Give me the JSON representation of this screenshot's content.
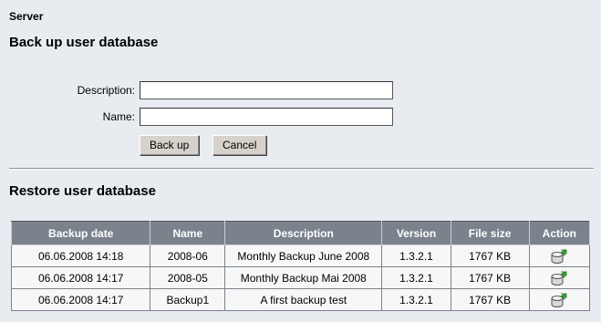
{
  "breadcrumb": "Server",
  "backup": {
    "title": "Back up user database",
    "description_label": "Description:",
    "description_value": "",
    "name_label": "Name:",
    "name_value": "",
    "backup_button": "Back up",
    "cancel_button": "Cancel"
  },
  "restore": {
    "title": "Restore user database",
    "columns": [
      "Backup date",
      "Name",
      "Description",
      "Version",
      "File size",
      "Action"
    ],
    "rows": [
      {
        "date": "06.06.2008 14:18",
        "name": "2008-06",
        "description": "Monthly Backup June 2008",
        "version": "1.3.2.1",
        "size": "1767 KB",
        "action_icon": "restore-icon"
      },
      {
        "date": "06.06.2008 14:17",
        "name": "2008-05",
        "description": "Monthly Backup Mai 2008",
        "version": "1.3.2.1",
        "size": "1767 KB",
        "action_icon": "restore-icon"
      },
      {
        "date": "06.06.2008 14:17",
        "name": "Backup1",
        "description": "A first backup test",
        "version": "1.3.2.1",
        "size": "1767 KB",
        "action_icon": "restore-icon"
      }
    ]
  },
  "colors": {
    "background": "#e8ecf1",
    "table_header": "#7a838c",
    "icon_green": "#3aa635"
  }
}
